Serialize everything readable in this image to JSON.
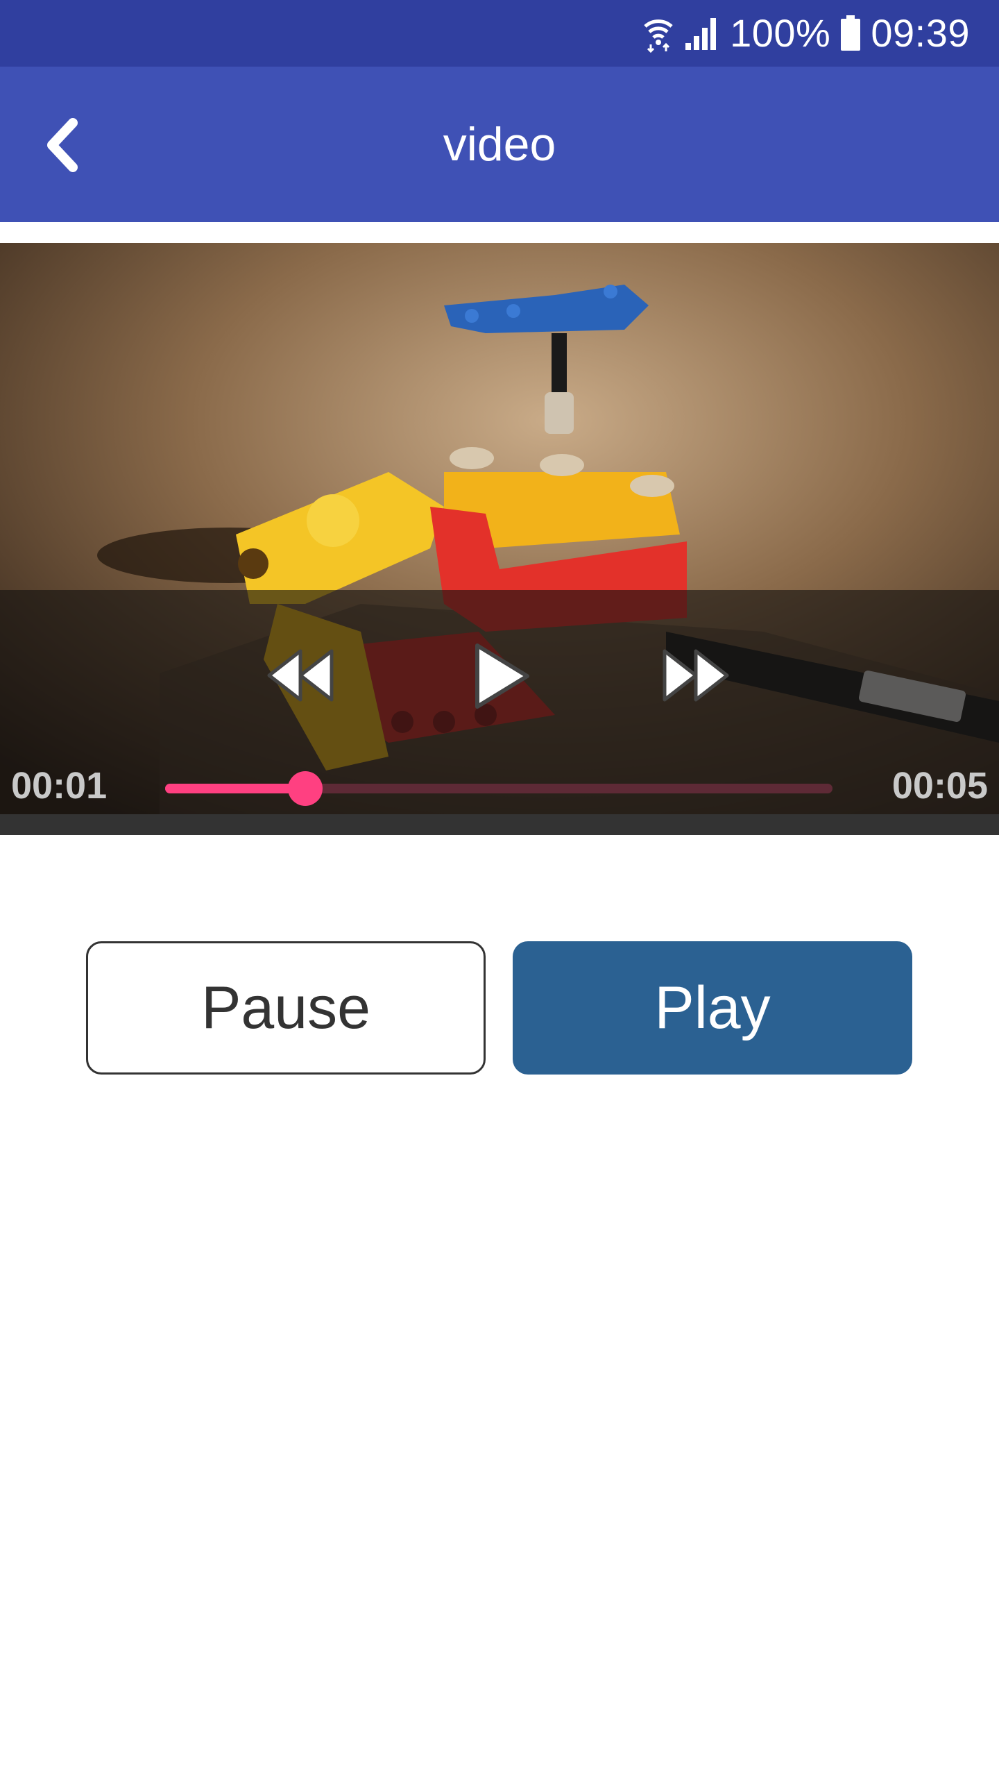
{
  "status_bar": {
    "battery": "100%",
    "time": "09:39",
    "icons": [
      "wifi-icon",
      "signal-icon",
      "battery-icon"
    ]
  },
  "app_bar": {
    "title": "video",
    "back_icon": "chevron-left-icon"
  },
  "video": {
    "elapsed": "00:01",
    "duration": "00:05",
    "progress_fraction": 0.21,
    "controls": [
      "rewind-icon",
      "play-icon",
      "fast-forward-icon"
    ]
  },
  "buttons": {
    "pause_label": "Pause",
    "play_label": "Play"
  },
  "colors": {
    "status_bar": "#303f9f",
    "app_bar": "#3f51b5",
    "seek_accent": "#ff4081",
    "play_button": "#2b6192"
  }
}
